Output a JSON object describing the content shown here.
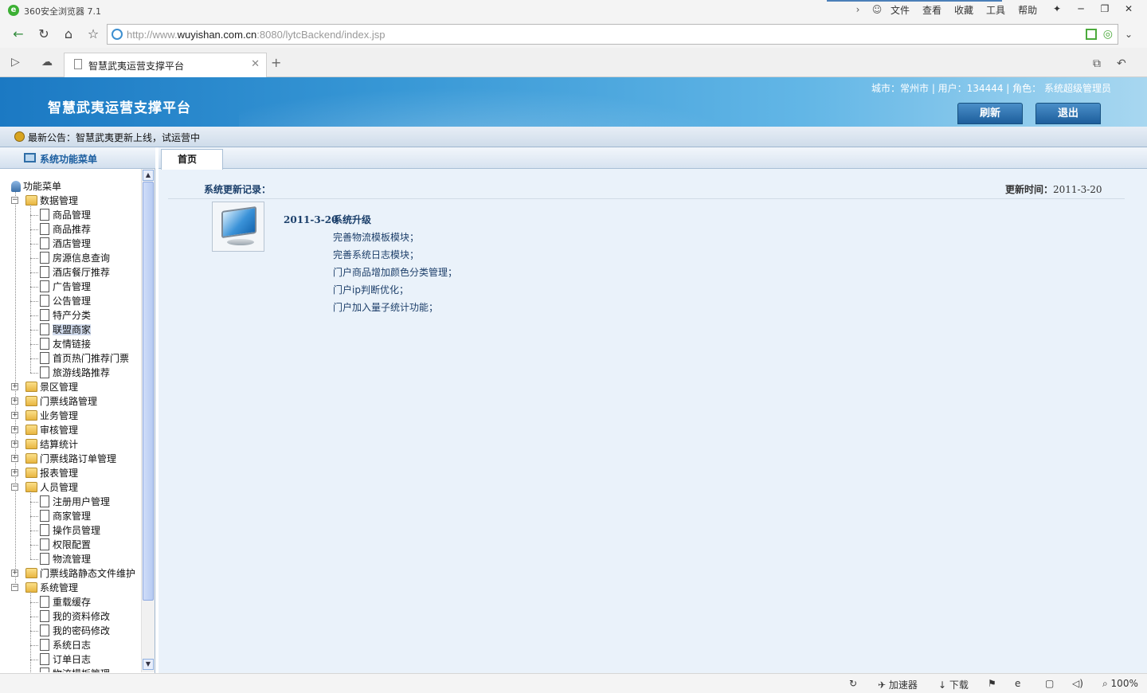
{
  "browser": {
    "app_title": "360安全浏览器 7.1",
    "menu": [
      "文件",
      "查看",
      "收藏",
      "工具",
      "帮助"
    ],
    "url_prefix": "http://www.",
    "url_domain": "wuyishan.com.cn",
    "url_suffix": ":8080/lytcBackend/index.jsp",
    "tab_label": "智慧武夷运营支撑平台",
    "status": {
      "accelerator": "加速器",
      "download": "下载",
      "zoom": "100%"
    }
  },
  "header": {
    "title": "智慧武夷运营支撑平台",
    "user_info": "城市：常州市  | 用户：134444 |  角色：  系统超级管理员",
    "refresh_label": "刷新",
    "logout_label": "退出"
  },
  "notice": "最新公告：智慧武夷更新上线，试运营中",
  "sidebar": {
    "title": "系统功能菜单",
    "root": "功能菜单",
    "groups": [
      {
        "label": "数据管理",
        "expanded": true,
        "items": [
          "商品管理",
          "商品推荐",
          "酒店管理",
          "房源信息查询",
          "酒店餐厅推荐",
          "广告管理",
          "公告管理",
          "特产分类",
          "联盟商家",
          "友情链接",
          "首页热门推荐门票",
          "旅游线路推荐"
        ]
      },
      {
        "label": "景区管理",
        "expanded": false,
        "items": []
      },
      {
        "label": "门票线路管理",
        "expanded": false,
        "items": []
      },
      {
        "label": "业务管理",
        "expanded": false,
        "items": []
      },
      {
        "label": "审核管理",
        "expanded": false,
        "items": []
      },
      {
        "label": "结算统计",
        "expanded": false,
        "items": []
      },
      {
        "label": "门票线路订单管理",
        "expanded": false,
        "items": []
      },
      {
        "label": "报表管理",
        "expanded": false,
        "items": []
      },
      {
        "label": "人员管理",
        "expanded": true,
        "items": [
          "注册用户管理",
          "商家管理",
          "操作员管理",
          "权限配置",
          "物流管理"
        ]
      },
      {
        "label": "门票线路静态文件维护",
        "expanded": false,
        "items": []
      },
      {
        "label": "系统管理",
        "expanded": true,
        "items": [
          "重载缓存",
          "我的资料修改",
          "我的密码修改",
          "系统日志",
          "订单日志",
          "物流模板管理"
        ]
      }
    ],
    "selected_item": "联盟商家"
  },
  "main": {
    "tab_home": "首页",
    "update_title": "系统更新记录：",
    "update_time_label": "更新时间：",
    "update_time_value": "2011-3-20",
    "record": {
      "date": "2011-3-20",
      "heading": "系统升级",
      "lines": [
        "完善物流模板模块；",
        "完善系统日志模块；",
        "门户商品增加颜色分类管理；",
        "门户ip判断优化；",
        "门户加入量子统计功能；"
      ]
    }
  }
}
